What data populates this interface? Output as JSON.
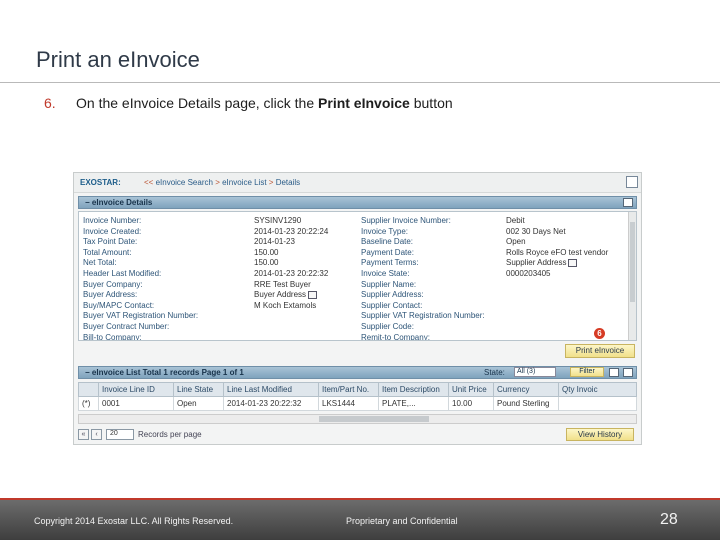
{
  "slide": {
    "title": "Print an eInvoice",
    "step_number": "6.",
    "step_text_pre": "On the eInvoice Details page, click the ",
    "step_text_bold": "Print eInvoice",
    "step_text_post": " button"
  },
  "screenshot": {
    "breadcrumb": {
      "logo": "EXOSTAR:",
      "separator": "<<",
      "items": [
        "eInvoice Search",
        "eInvoice List",
        "Details"
      ]
    },
    "details_panel": {
      "title": "eInvoice Details",
      "left_labels": [
        "Invoice Number:",
        "Invoice Created:",
        "Tax Point Date:",
        "Total Amount:",
        "Net Total:",
        "Header Last Modified:",
        "Buyer Company:",
        "Buyer Address:",
        "Buy/MAPC Contact:",
        "Buyer VAT Registration Number:",
        "Buyer Contract Number:",
        "Bill-to Company:"
      ],
      "left_values": [
        "SYSINV1290",
        "2014-01-23 20:22:24",
        "2014-01-23",
        "150.00",
        "150.00",
        "2014-01-23 20:22:32",
        "RRE Test Buyer",
        "Buyer Address",
        "M Koch Extamols",
        "",
        "",
        ""
      ],
      "right_labels": [
        "Supplier Invoice Number:",
        "Invoice Type:",
        "Baseline Date:",
        "Payment Date:",
        "Payment Terms:",
        "Invoice State:",
        "Supplier Name:",
        "Supplier Address:",
        "Supplier Contact:",
        "Supplier VAT Registration Number:",
        "Supplier Code:",
        "Remit-to Company:"
      ],
      "right_values": [
        "",
        "Debit",
        "",
        "",
        "002 30 Days Net",
        "Open",
        "Rolls Royce eFO test vendor",
        "Supplier Address",
        "",
        "",
        "0000203405",
        ""
      ],
      "badge": "6",
      "print_button": "Print eInvoice"
    },
    "list_panel": {
      "title": "eInvoice List Total 1 records Page 1 of 1",
      "state_label": "State:",
      "state_value": "All (3)",
      "filter_button": "Filter",
      "columns": [
        "",
        "Invoice Line ID",
        "Line State",
        "Line Last Modified",
        "Item/Part No.",
        "Item Description",
        "Unit Price",
        "Currency",
        "Qty Invoic"
      ],
      "rows": [
        [
          "(*)",
          "0001",
          "Open",
          "2014-01-23 20:22:32",
          "LKS1444",
          "PLATE,...",
          "10.00",
          "Pound Sterling",
          ""
        ]
      ]
    },
    "pager": {
      "page_size": "20",
      "records_label": "Records per page",
      "history_button": "View History"
    }
  },
  "footer": {
    "copyright": "Copyright 2014 Exostar LLC. All Rights Reserved.",
    "confidential": "Proprietary and Confidential",
    "page_number": "28"
  },
  "colors": {
    "accent_red": "#c0392b",
    "panel_header": "#8fb0c8",
    "button_yellow": "#f1e08a"
  }
}
